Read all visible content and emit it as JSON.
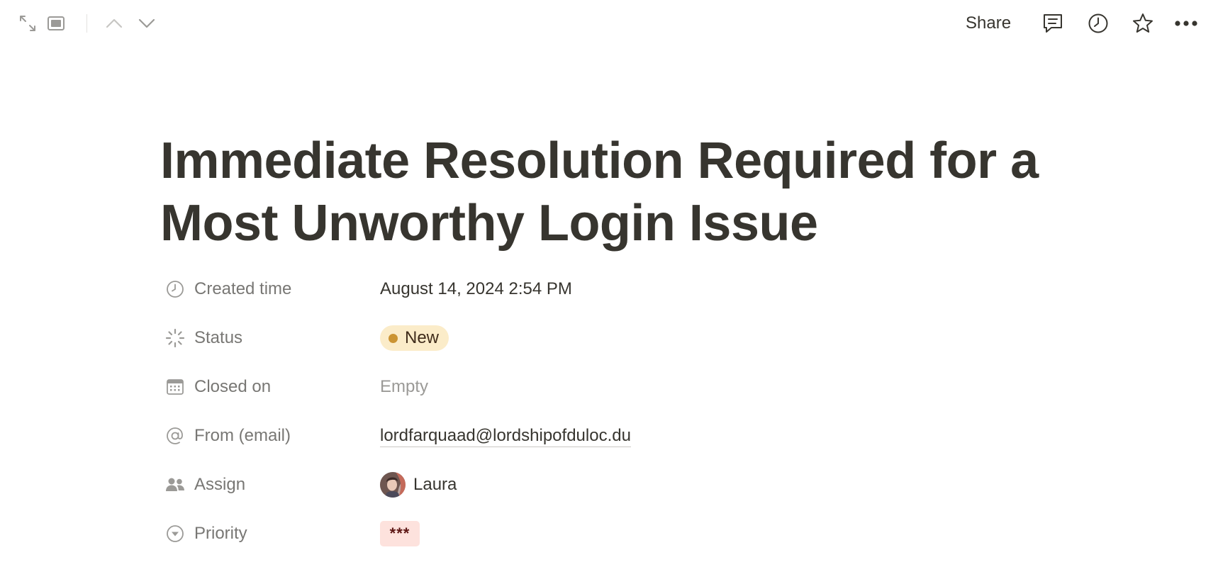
{
  "topbar": {
    "left_icons": [
      "expand-icon",
      "peek-mode-icon",
      "chevron-up-icon",
      "chevron-down-icon"
    ],
    "share_label": "Share",
    "right_icons": [
      "comment-icon",
      "history-icon",
      "star-icon",
      "more-icon"
    ]
  },
  "page": {
    "title": "Immediate Resolution Required for a Most Unworthy Login Issue"
  },
  "properties": [
    {
      "key": "Created time",
      "icon": "clock-icon",
      "value": "August 14, 2024 2:54 PM"
    },
    {
      "key": "Status",
      "icon": "status-spinner-icon",
      "value": "New",
      "pill_color": "#fbecc9",
      "dot_color": "#cb9433"
    },
    {
      "key": "Closed on",
      "icon": "calendar-icon",
      "value": "Empty"
    },
    {
      "key": "From (email)",
      "icon": "at-sign-icon",
      "value": "lordfarquaad@lordshipofduloc.du"
    },
    {
      "key": "Assign",
      "icon": "people-icon",
      "value": "Laura"
    },
    {
      "key": "Priority",
      "icon": "select-arrow-icon",
      "value": "***",
      "pill_color": "#fde2dd"
    }
  ]
}
